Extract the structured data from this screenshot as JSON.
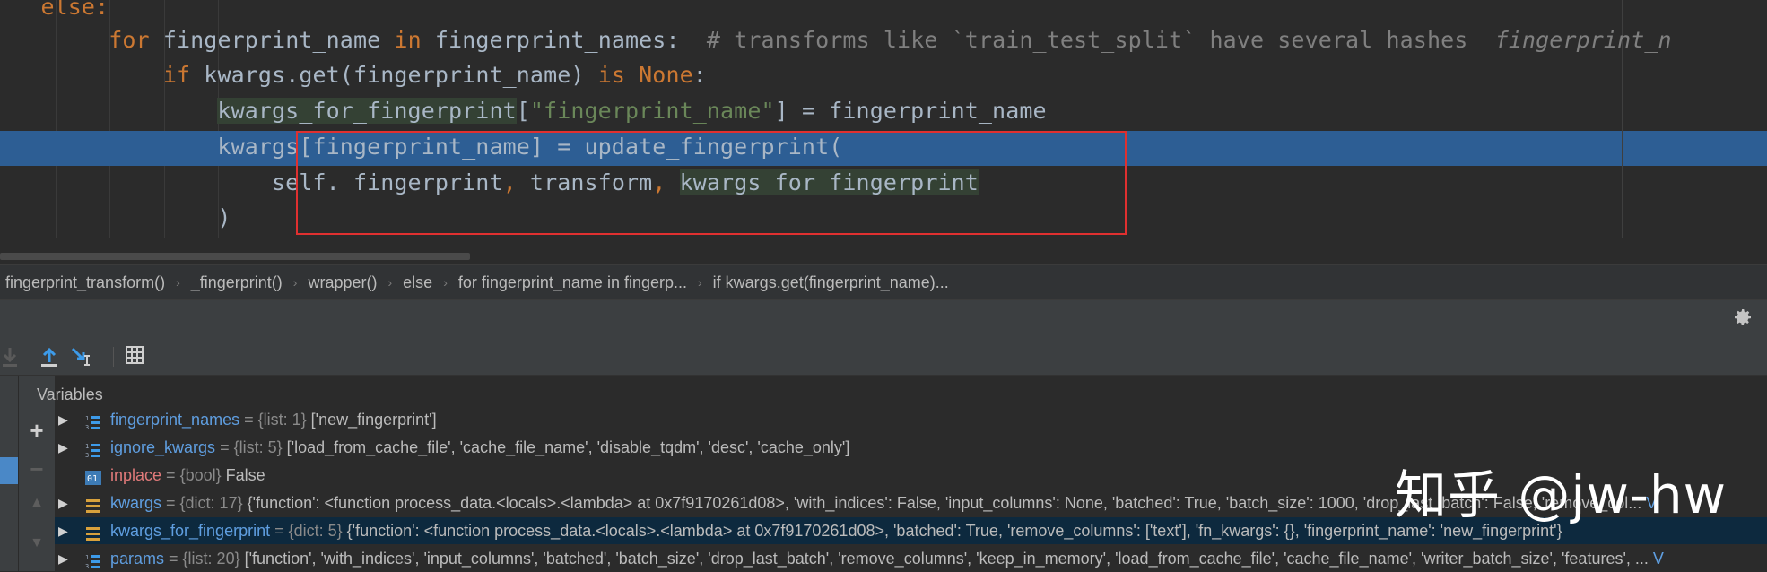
{
  "editor": {
    "lines": [
      {
        "indent": "   ",
        "tokens": [
          {
            "t": "else:",
            "c": "kw"
          }
        ]
      },
      {
        "indent": "        ",
        "tokens": [
          {
            "t": "for",
            "c": "kw"
          },
          {
            "t": " fingerprint_name ",
            "c": ""
          },
          {
            "t": "in",
            "c": "kw"
          },
          {
            "t": " fingerprint_names:  ",
            "c": ""
          },
          {
            "t": "# transforms like `train_test_split` have several hashes  ",
            "c": "cm"
          },
          {
            "t": "fingerprint_n",
            "c": "cmi"
          }
        ]
      },
      {
        "indent": "            ",
        "tokens": [
          {
            "t": "if",
            "c": "kw"
          },
          {
            "t": " kwargs.get(fingerprint_name) ",
            "c": ""
          },
          {
            "t": "is",
            "c": "kw"
          },
          {
            "t": " ",
            "c": ""
          },
          {
            "t": "None",
            "c": "kw"
          },
          {
            "t": ":",
            "c": ""
          }
        ]
      },
      {
        "indent": "                ",
        "tokens": [
          {
            "t": "kwargs_for_fingerprint",
            "c": "bgg"
          },
          {
            "t": "[",
            "c": ""
          },
          {
            "t": "\"fingerprint_name\"",
            "c": "str"
          },
          {
            "t": "] = fingerprint_name",
            "c": ""
          }
        ]
      },
      {
        "indent": "                ",
        "tokens": [
          {
            "t": "kwargs[fingerprint_name] = update_fingerprint(",
            "c": ""
          }
        ]
      },
      {
        "indent": "                    ",
        "tokens": [
          {
            "t": "self._fingerprint",
            "c": ""
          },
          {
            "t": ",",
            "c": "kw"
          },
          {
            "t": " transform",
            "c": ""
          },
          {
            "t": ",",
            "c": "kw"
          },
          {
            "t": " ",
            "c": ""
          },
          {
            "t": "kwargs_for_fingerprint",
            "c": "bgg"
          }
        ]
      },
      {
        "indent": "                ",
        "tokens": [
          {
            "t": ")",
            "c": ""
          }
        ]
      }
    ]
  },
  "breadcrumb": [
    "fingerprint_transform()",
    "_fingerprint()",
    "wrapper()",
    "else",
    "for fingerprint_name in fingerp...",
    "if kwargs.get(fingerprint_name)..."
  ],
  "debug": {
    "vars_title": "Variables",
    "gear_icon": "gear-icon",
    "variables": [
      {
        "name": "fingerprint_names",
        "type": "{list: 1}",
        "value": "['new_fingerprint']",
        "icon": "list-icon",
        "expandable": true,
        "name_color": "blue",
        "more": ""
      },
      {
        "name": "ignore_kwargs",
        "type": "{list: 5}",
        "value": "['load_from_cache_file', 'cache_file_name', 'disable_tqdm', 'desc', 'cache_only']",
        "icon": "list-icon",
        "expandable": true,
        "name_color": "blue",
        "more": ""
      },
      {
        "name": "inplace",
        "type": "{bool}",
        "value": "False",
        "icon": "bool-icon",
        "expandable": false,
        "name_color": "red",
        "more": ""
      },
      {
        "name": "kwargs",
        "type": "{dict: 17}",
        "value": "{'function': <function process_data.<locals>.<lambda> at 0x7f9170261d08>, 'with_indices': False, 'input_columns': None, 'batched': True, 'batch_size': 1000, 'drop_last_batch': False, 'remove_col...",
        "icon": "dict-icon",
        "expandable": true,
        "name_color": "blue",
        "more": "V"
      },
      {
        "name": "kwargs_for_fingerprint",
        "type": "{dict: 5}",
        "value": "{'function': <function process_data.<locals>.<lambda> at 0x7f9170261d08>, 'batched': True, 'remove_columns': ['text'], 'fn_kwargs': {}, 'fingerprint_name': 'new_fingerprint'}",
        "icon": "dict-icon",
        "expandable": true,
        "name_color": "blue",
        "more": "",
        "selected": true
      },
      {
        "name": "params",
        "type": "{list: 20}",
        "value": "['function', 'with_indices', 'input_columns', 'batched', 'batch_size', 'drop_last_batch', 'remove_columns', 'keep_in_memory', 'load_from_cache_file', 'cache_file_name', 'writer_batch_size', 'features', ...",
        "icon": "list-icon",
        "expandable": true,
        "name_color": "blue",
        "more": "V"
      }
    ]
  },
  "watermark": "知乎 @jw-hw",
  "colors": {
    "editor_bg": "#2b2b2b",
    "highlight_row": "#2d5e94",
    "annotation_box": "#e03030",
    "keyword": "#cc7832",
    "string": "#6a8759",
    "comment": "#808080",
    "var_name": "#5f9ee0"
  }
}
